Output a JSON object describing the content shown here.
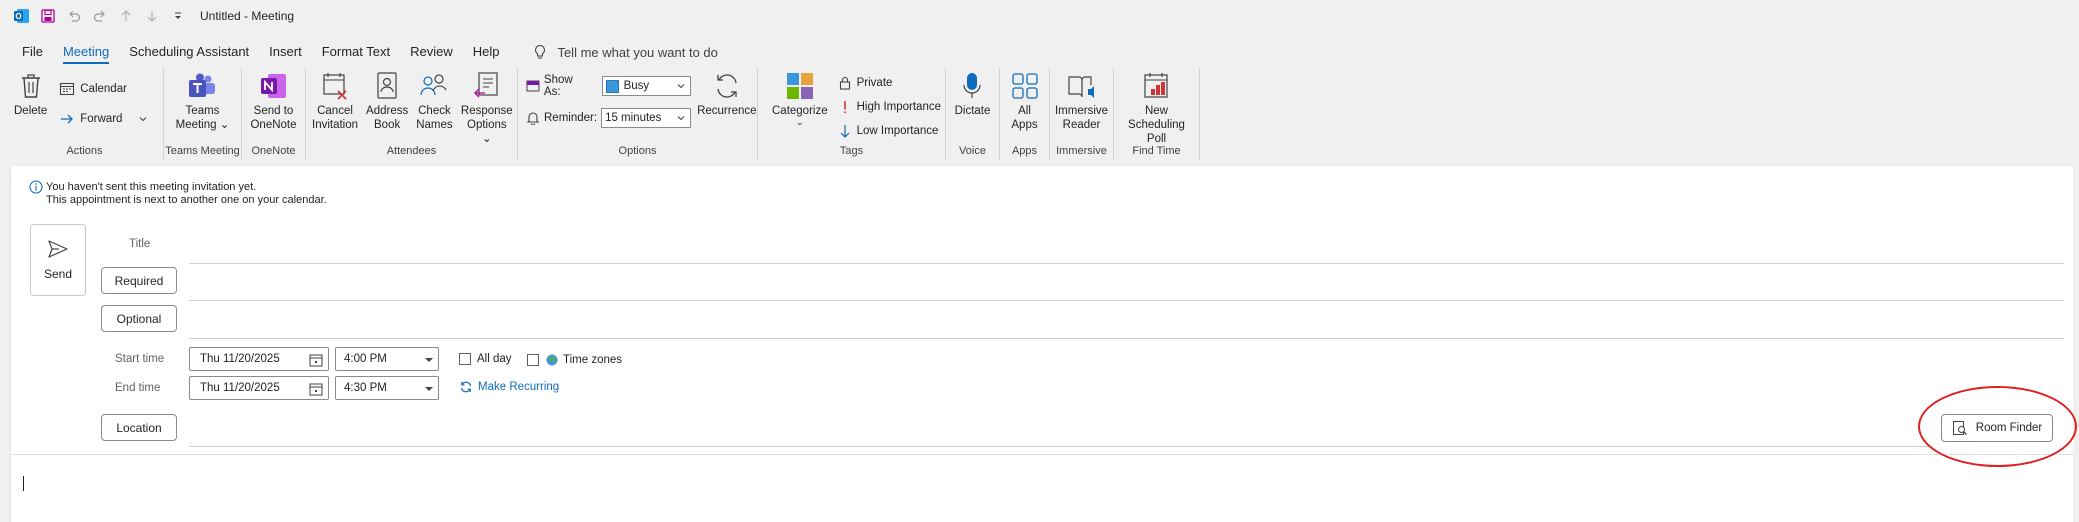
{
  "titlebar": {
    "title": "Untitled  -  Meeting",
    "quick_access": [
      "outlook-logo-icon",
      "save-icon",
      "undo-icon",
      "redo-icon",
      "up-arrow-icon",
      "down-arrow-icon",
      "customize-icon"
    ]
  },
  "menu": {
    "tabs": [
      "File",
      "Meeting",
      "Scheduling Assistant",
      "Insert",
      "Format Text",
      "Review",
      "Help"
    ],
    "active_tab": "Meeting",
    "tell_me": "Tell me what you want to do"
  },
  "ribbon": {
    "actions": {
      "label": "Actions",
      "delete": "Delete",
      "calendar": "Calendar",
      "forward": "Forward"
    },
    "teams_meeting": {
      "label": "Teams Meeting",
      "button_line1": "Teams",
      "button_line2": "Meeting"
    },
    "onenote": {
      "label": "OneNote",
      "button_line1": "Send to",
      "button_line2": "OneNote"
    },
    "attendees": {
      "label": "Attendees",
      "cancel_line1": "Cancel",
      "cancel_line2": "Invitation",
      "address_line1": "Address",
      "address_line2": "Book",
      "check_line1": "Check",
      "check_line2": "Names",
      "response_line1": "Response",
      "response_line2": "Options"
    },
    "options": {
      "label": "Options",
      "show_as_label": "Show As:",
      "show_as_value": "Busy",
      "reminder_label": "Reminder:",
      "reminder_value": "15 minutes",
      "recurrence": "Recurrence"
    },
    "tags": {
      "label": "Tags",
      "categorize": "Categorize",
      "private": "Private",
      "high_importance": "High Importance",
      "low_importance": "Low Importance"
    },
    "voice": {
      "label": "Voice",
      "dictate": "Dictate"
    },
    "apps": {
      "label": "Apps",
      "button_line1": "All",
      "button_line2": "Apps"
    },
    "immersive": {
      "label": "Immersive",
      "button_line1": "Immersive",
      "button_line2": "Reader"
    },
    "find_time": {
      "label": "Find Time",
      "button_line1": "New",
      "button_line2": "Scheduling Poll"
    }
  },
  "form": {
    "info_line1": "You haven't sent this meeting invitation yet.",
    "info_line2": "This appointment is next to another one on your calendar.",
    "send": "Send",
    "title_label": "Title",
    "required": "Required",
    "optional": "Optional",
    "start_time_label": "Start time",
    "end_time_label": "End time",
    "start_date": "Thu 11/20/2025",
    "start_time": "4:00 PM",
    "end_date": "Thu 11/20/2025",
    "end_time": "4:30 PM",
    "all_day": "All day",
    "time_zones": "Time zones",
    "make_recurring": "Make Recurring",
    "location": "Location",
    "room_finder": "Room Finder"
  },
  "colors": {
    "accent": "#0f6cbd",
    "highlight": "#e01e1e",
    "importance_high": "#d13438"
  }
}
